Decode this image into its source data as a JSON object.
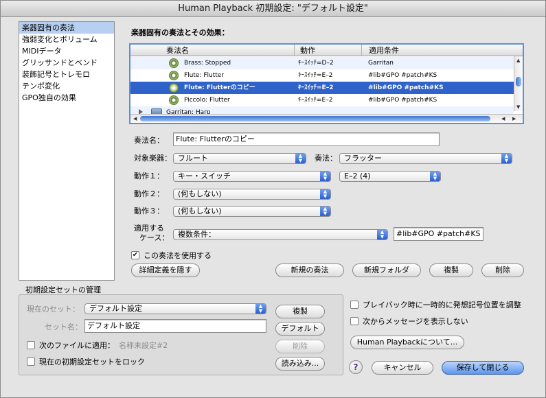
{
  "window": {
    "title": "Human Playback 初期設定: \"デフォルト設定\""
  },
  "sidebar": {
    "items": [
      {
        "label": "楽器固有の奏法",
        "selected": true
      },
      {
        "label": "強弱変化とボリューム"
      },
      {
        "label": "MIDIデータ"
      },
      {
        "label": "グリッサンドとベンド"
      },
      {
        "label": "装飾記号とトレモロ"
      },
      {
        "label": "テンポ変化"
      },
      {
        "label": "GPO独自の効果"
      }
    ]
  },
  "main": {
    "heading": "楽器固有の奏法とその効果：",
    "table": {
      "columns": [
        "奏法名",
        "動作",
        "適用条件"
      ],
      "rows": [
        {
          "name": "Brass: Stopped",
          "action": "ｷｰｽｲｯﾁ=D–2",
          "condition": "Garritan"
        },
        {
          "name": "Flute: Flutter",
          "action": "ｷｰｽｲｯﾁ=E–2",
          "condition": "#lib#GPO #patch#KS"
        },
        {
          "name": "Flute: Flutterのコピー",
          "action": "ｷｰｽｲｯﾁ=E–2",
          "condition": "#lib#GPO #patch#KS",
          "selected": true
        },
        {
          "name": "Piccolo: Flutter",
          "action": "ｷｰｽｲｯﾁ=E–2",
          "condition": "#lib#GPO #patch#KS"
        },
        {
          "name": "Garritan: Harp",
          "folder": true
        }
      ]
    },
    "form": {
      "name_label": "奏法名：",
      "name_value": "Flute: Flutterのコピー",
      "instrument_label": "対象楽器：",
      "instrument_value": "フルート",
      "technique_label": "奏法：",
      "technique_value": "フラッター",
      "action1_label": "動作１：",
      "action1_value": "キー・スイッチ",
      "action1_key": "E–2 (4)",
      "action2_label": "動作２：",
      "action2_value": "(何もしない)",
      "action3_label": "動作３：",
      "action3_value": "(何もしない)",
      "case_label_1": "適用する",
      "case_label_2": "ケース：",
      "case_value": "複数条件：",
      "case_text": "#lib#GPO #patch#KS",
      "use_checkbox_label": "この奏法を使用する"
    },
    "buttons": {
      "hide_details": "詳細定義を隠す",
      "new_technique": "新規の奏法",
      "new_folder": "新規フォルダ",
      "duplicate": "複製",
      "delete": "削除"
    }
  },
  "presets": {
    "group_title": "初期設定セットの管理",
    "current_set_label": "現在のセット：",
    "current_set_value": "デフォルト設定",
    "set_name_label": "セット名：",
    "set_name_value": "デフォルト設定",
    "apply_to_file_label": "次のファイルに適用：",
    "apply_to_file_value": "名称未設定#2",
    "lock_label": "現在の初期設定セットをロック",
    "btn_duplicate": "複製",
    "btn_default": "デフォルト",
    "btn_delete": "削除",
    "btn_load": "読み込み..."
  },
  "options": {
    "adjust_label": "プレイバック時に一時的に発想記号位置を調整",
    "no_message_label": "次からメッセージを表示しない",
    "about_button": "Human Playbackについて...",
    "help_icon": "?",
    "cancel_button": "キャンセル",
    "save_close_button": "保存して閉じる"
  }
}
